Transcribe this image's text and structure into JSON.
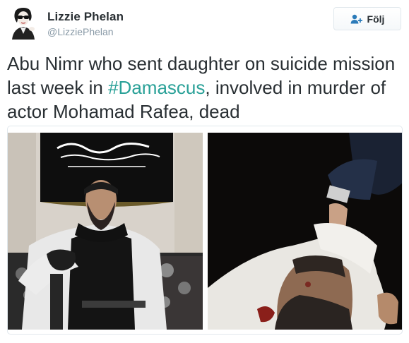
{
  "tweet": {
    "author_name": "Lizzie Phelan",
    "author_handle": "@LizziePhelan",
    "follow_label": "Följ",
    "text_before": "Abu Nimr who sent daughter on suicide mission last week in ",
    "hashtag_symbol": "#",
    "hashtag_word": "Damascus",
    "text_after": ", involved in murder of actor Mohamad Rafea, dead"
  },
  "icons": {
    "follow": "add-person-icon",
    "avatar": "profile-avatar"
  },
  "colors": {
    "name": "#292f33",
    "handle": "#8899a6",
    "hashtag": "#2aa198",
    "follow_icon": "#2b7bb9",
    "border": "#e1e8ed"
  }
}
